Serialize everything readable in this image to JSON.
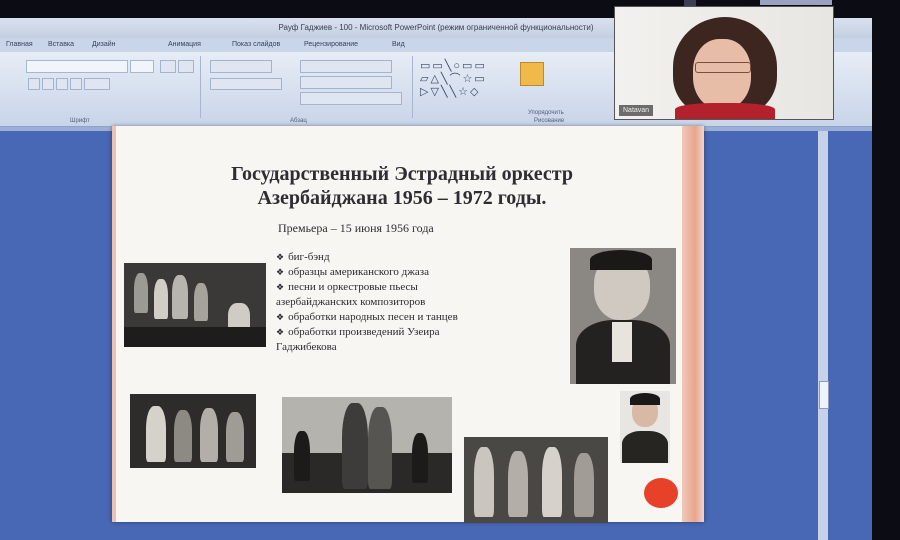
{
  "window": {
    "title": "Рауф Гаджиев - 100 - Microsoft PowerPoint (режим ограниченной функциональности)"
  },
  "ribbon": {
    "tabs": [
      "Главная",
      "Вставка",
      "Дизайн",
      "Анимация",
      "Показ слайдов",
      "Рецензирование",
      "Вид"
    ],
    "groups": [
      "Шрифт",
      "Абзац",
      "Рисование"
    ],
    "shapes_label": "Упорядочить"
  },
  "slide": {
    "title_line1": "Государственный Эстрадный оркестр",
    "title_line2": "Азербайджана  1956 – 1972 годы.",
    "subtitle": "Премьера – 15 июня 1956 года",
    "bullets": [
      "биг-бэнд",
      "образцы американского джаза",
      "песни и оркестровые пьесы",
      "азербайджанских композиторов",
      "обработки народных песен и танцев",
      "обработки произведений Узеира",
      "Гаджибекова"
    ],
    "bullet_markers": [
      true,
      true,
      true,
      false,
      true,
      true,
      false
    ],
    "accent_color": "#e8412a"
  },
  "webcam": {
    "participant_name": "Natavan"
  }
}
